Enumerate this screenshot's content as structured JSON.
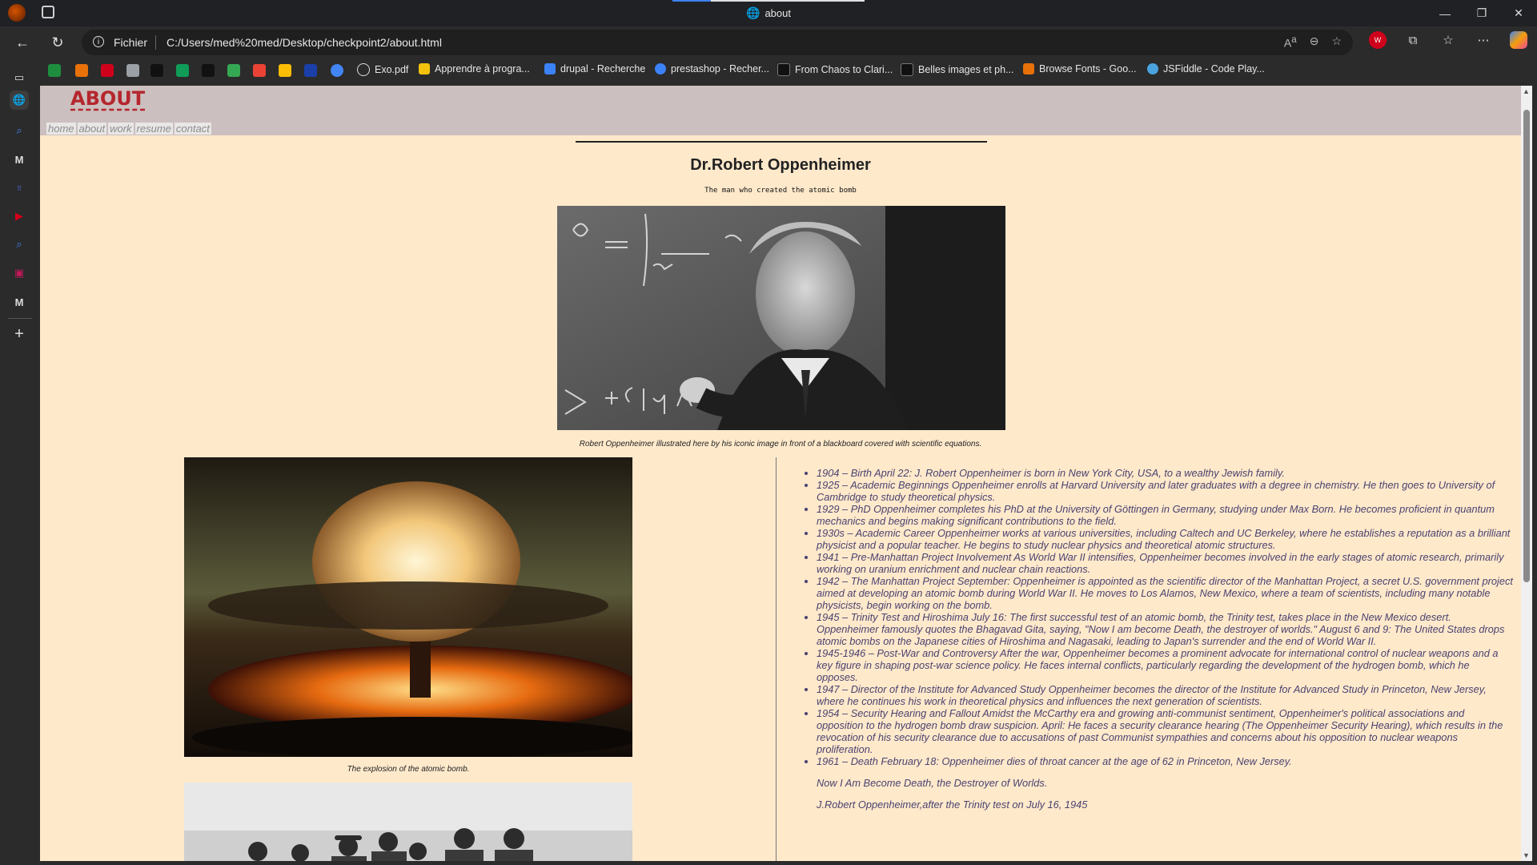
{
  "browser": {
    "window_title": "about",
    "address": {
      "scheme": "Fichier",
      "url": "C:/Users/med%20med/Desktop/checkpoint2/about.html"
    },
    "bookmarks": [
      {
        "label": "Exo.pdf",
        "color": "#dddddd"
      },
      {
        "label": "Apprendre à progra...",
        "color": "#f4c20d"
      },
      {
        "label": "drupal - Recherche",
        "color": "#3b82f6"
      },
      {
        "label": "prestashop - Recher...",
        "color": "#3b82f6"
      },
      {
        "label": "From Chaos to Clari...",
        "color": "#111111"
      },
      {
        "label": "Belles images et ph...",
        "color": "#111111"
      },
      {
        "label": "Browse Fonts - Goo...",
        "color": "#e8710a"
      },
      {
        "label": "JSFiddle - Code Play...",
        "color": "#4aa3df"
      }
    ]
  },
  "site": {
    "brand": "ABOUT",
    "menu": [
      "home",
      "about",
      "work",
      "resume",
      "contact"
    ],
    "title": "Dr.Robert Oppenheimer",
    "subtitle": "The man who created the atomic bomb",
    "hero_caption": "Robert Oppenheimer illustrated here by his iconic image in front of a blackboard covered with scientific equations.",
    "bomb_caption": "The explosion of the atomic bomb.",
    "timeline": [
      "1904 – Birth April 22: J. Robert Oppenheimer is born in New York City, USA, to a wealthy Jewish family.",
      "1925 – Academic Beginnings Oppenheimer enrolls at Harvard University and later graduates with a degree in chemistry. He then goes to University of Cambridge to study theoretical physics.",
      "1929 – PhD Oppenheimer completes his PhD at the University of Göttingen in Germany, studying under Max Born. He becomes proficient in quantum mechanics and begins making significant contributions to the field.",
      "1930s – Academic Career Oppenheimer works at various universities, including Caltech and UC Berkeley, where he establishes a reputation as a brilliant physicist and a popular teacher. He begins to study nuclear physics and theoretical atomic structures.",
      "1941 – Pre-Manhattan Project Involvement As World War II intensifies, Oppenheimer becomes involved in the early stages of atomic research, primarily working on uranium enrichment and nuclear chain reactions.",
      "1942 – The Manhattan Project September: Oppenheimer is appointed as the scientific director of the Manhattan Project, a secret U.S. government project aimed at developing an atomic bomb during World War II. He moves to Los Alamos, New Mexico, where a team of scientists, including many notable physicists, begin working on the bomb.",
      "1945 – Trinity Test and Hiroshima July 16: The first successful test of an atomic bomb, the Trinity test, takes place in the New Mexico desert. Oppenheimer famously quotes the Bhagavad Gita, saying, \"Now I am become Death, the destroyer of worlds.\" August 6 and 9: The United States drops atomic bombs on the Japanese cities of Hiroshima and Nagasaki, leading to Japan's surrender and the end of World War II.",
      "1945-1946 – Post-War and Controversy After the war, Oppenheimer becomes a prominent advocate for international control of nuclear weapons and a key figure in shaping post-war science policy. He faces internal conflicts, particularly regarding the development of the hydrogen bomb, which he opposes.",
      "1947 – Director of the Institute for Advanced Study Oppenheimer becomes the director of the Institute for Advanced Study in Princeton, New Jersey, where he continues his work in theoretical physics and influences the next generation of scientists.",
      "1954 – Security Hearing and Fallout Amidst the McCarthy era and growing anti-communist sentiment, Oppenheimer's political associations and opposition to the hydrogen bomb draw suspicion. April: He faces a security clearance hearing (The Oppenheimer Security Hearing), which results in the revocation of his security clearance due to accusations of past Communist sympathies and concerns about his opposition to nuclear weapons proliferation.",
      "1961 – Death February 18: Oppenheimer dies of throat cancer at the age of 62 in Princeton, New Jersey."
    ],
    "quote": "Now I Am Become Death, the Destroyer of Worlds.",
    "attribution": "J.Robert Oppenheimer,after the Trinity test on July 16, 1945"
  }
}
